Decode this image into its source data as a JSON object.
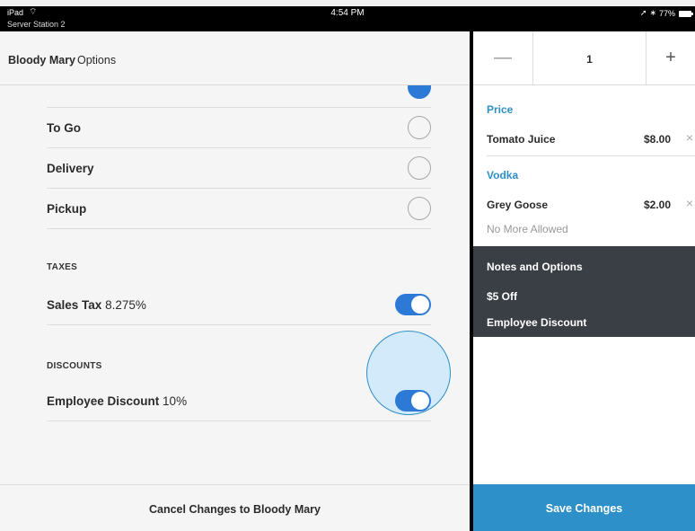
{
  "status_bar": {
    "device": "iPad",
    "wifi_glyph": "⌔",
    "station": "Server Station 2",
    "time": "4:54 PM",
    "location_glyph": "➚",
    "bluetooth_glyph": "∗",
    "battery": "77%"
  },
  "header": {
    "item_name": "Bloody Mary",
    "suffix": "Options"
  },
  "dining_options": [
    {
      "label": "To Go",
      "selected": false
    },
    {
      "label": "Delivery",
      "selected": false
    },
    {
      "label": "Pickup",
      "selected": false
    }
  ],
  "taxes": {
    "section_label": "TAXES",
    "name": "Sales Tax",
    "rate": "8.275%",
    "enabled": true
  },
  "discounts": {
    "section_label": "DISCOUNTS",
    "name": "Employee Discount",
    "rate": "10%",
    "enabled": true
  },
  "cancel_label": "Cancel Changes to Bloody Mary",
  "stepper": {
    "minus": "—",
    "quantity": "1",
    "plus": "+"
  },
  "modifiers": {
    "price_section": "Price",
    "price_item": {
      "name": "Tomato Juice",
      "price": "$8.00"
    },
    "vodka_section": "Vodka",
    "vodka_item": {
      "name": "Grey Goose",
      "price": "$2.00"
    },
    "limit_note": "No More Allowed",
    "remove_glyph": "×"
  },
  "notes": {
    "title": "Notes and Options",
    "lines": [
      "$5 Off",
      "Employee Discount"
    ]
  },
  "save_label": "Save Changes",
  "colors": {
    "accent_blue": "#2d7ad6",
    "section_blue": "#2d90c8",
    "notes_bg": "#3a3e45"
  }
}
